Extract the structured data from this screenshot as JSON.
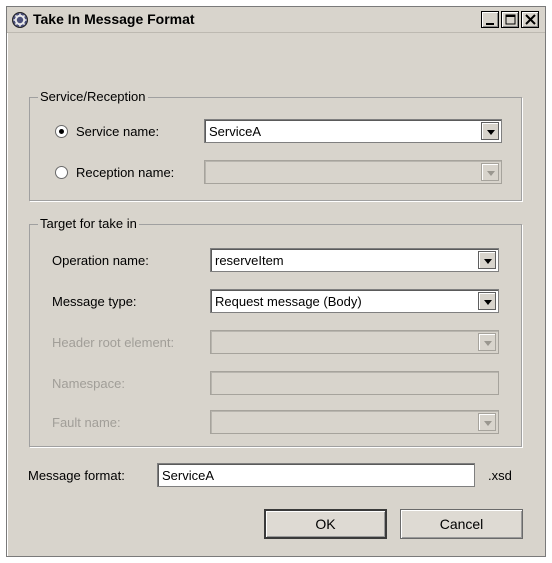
{
  "window": {
    "title": "Take In Message Format",
    "controls": {
      "minimize": "minimize-icon",
      "maximize": "maximize-icon",
      "close": "close-icon"
    }
  },
  "service_group": {
    "legend": "Service/Reception",
    "service_name": {
      "label": "Service name:",
      "selected": true,
      "value": "ServiceA"
    },
    "reception_name": {
      "label": "Reception name:",
      "selected": false,
      "value": ""
    }
  },
  "target_group": {
    "legend": "Target for take in",
    "operation_name": {
      "label": "Operation name:",
      "value": "reserveItem"
    },
    "message_type": {
      "label": "Message type:",
      "value": "Request message (Body)"
    },
    "header_root_element": {
      "label": "Header root element:",
      "value": ""
    },
    "namespace": {
      "label": "Namespace:",
      "value": ""
    },
    "fault_name": {
      "label": "Fault name:",
      "value": ""
    }
  },
  "message_format": {
    "label": "Message format:",
    "value": "ServiceA",
    "suffix": ".xsd"
  },
  "buttons": {
    "ok": "OK",
    "cancel": "Cancel"
  }
}
